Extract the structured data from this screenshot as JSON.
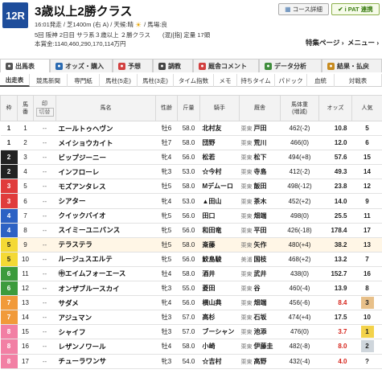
{
  "race": {
    "number": "12R",
    "name": "3歳以上2勝クラス",
    "line1_start": "16:01発走 / 芝1400m (右 A) / 天候:晴",
    "line1_end": "/ 馬場:良",
    "line2": "5回 阪神 2日目 サラ系３歳以上 ２勝クラス　　(混)[指] 定量 17頭",
    "line3": "本賞金:1140,460,290,170,114万円",
    "weather_icon": "sun-icon"
  },
  "header_buttons": {
    "course": "コース詳細",
    "ipat": "i PAT 連携"
  },
  "menu_links": {
    "special": "特集ページ",
    "more": "メニュー"
  },
  "main_tabs": [
    {
      "label": "出馬表",
      "icon": "list-icon",
      "color": "#555555"
    },
    {
      "label": "オッズ・購入",
      "icon": "odds-icon",
      "color": "#2a6ab1"
    },
    {
      "label": "予想",
      "icon": "target-icon",
      "color": "#d24040"
    },
    {
      "label": "調教",
      "icon": "stopwatch-icon",
      "color": "#444444"
    },
    {
      "label": "厩舎コメント",
      "icon": "comment-icon",
      "color": "#d24040"
    },
    {
      "label": "データ分析",
      "icon": "chart-icon",
      "color": "#3f8d3c"
    },
    {
      "label": "結果・払戻",
      "icon": "trophy-icon",
      "color": "#c78b1f"
    }
  ],
  "sub_tabs": [
    "出走表",
    "競馬新聞",
    "専門紙",
    "馬柱(5走)",
    "馬柱(3走)",
    "タイム指数",
    "メモ",
    "持ちタイム",
    "パドック",
    "血統",
    "対戦表"
  ],
  "columns": {
    "waku": "枠",
    "umaban": "馬\n番",
    "mark": "印",
    "mark_sub": "切替",
    "horse": "馬名",
    "sexage": "性齢",
    "kinryo": "斤量",
    "jockey": "騎手",
    "trainer": "厩舎",
    "weight": "馬体重\n(増減)",
    "odds": "オッズ",
    "pop": "人気"
  },
  "rows": [
    {
      "waku": "1",
      "umaban": "1",
      "mark": "--",
      "horse": "エールトゥヘヴン",
      "sexage": "牡6",
      "kinryo": "58.0",
      "jockey": "北村友",
      "belong": "栗東",
      "trainer": "戸田",
      "weight": "462(-2)",
      "odds": "10.8",
      "pop": "5"
    },
    {
      "waku": "1",
      "umaban": "2",
      "mark": "--",
      "horse": "メイショウカイト",
      "sexage": "牡7",
      "kinryo": "58.0",
      "jockey": "団野",
      "belong": "栗東",
      "trainer": "荒川",
      "weight": "466(0)",
      "odds": "12.0",
      "pop": "6"
    },
    {
      "waku": "2",
      "umaban": "3",
      "mark": "--",
      "horse": "ビップジーニー",
      "sexage": "牝4",
      "kinryo": "56.0",
      "jockey": "松若",
      "belong": "栗東",
      "trainer": "松下",
      "weight": "494(+8)",
      "odds": "57.6",
      "pop": "15"
    },
    {
      "waku": "2",
      "umaban": "4",
      "mark": "--",
      "horse": "インフローレ",
      "sexage": "牝3",
      "kinryo": "53.0",
      "jockey": "☆今村",
      "belong": "栗東",
      "trainer": "寺島",
      "weight": "412(-2)",
      "odds": "49.3",
      "pop": "14"
    },
    {
      "waku": "3",
      "umaban": "5",
      "mark": "--",
      "horse": "モズアンタレス",
      "sexage": "牡5",
      "kinryo": "58.0",
      "jockey": "Mデムーロ",
      "belong": "栗東",
      "trainer": "飯田",
      "weight": "498(-12)",
      "odds": "23.8",
      "pop": "12"
    },
    {
      "waku": "3",
      "umaban": "6",
      "mark": "--",
      "horse": "シアター",
      "sexage": "牝4",
      "kinryo": "53.0",
      "jockey": "▲田山",
      "belong": "栗東",
      "trainer": "茶木",
      "weight": "452(+2)",
      "odds": "14.0",
      "pop": "9"
    },
    {
      "waku": "4",
      "umaban": "7",
      "mark": "--",
      "horse": "クイックバイオ",
      "sexage": "牝5",
      "kinryo": "56.0",
      "jockey": "田口",
      "belong": "栗東",
      "trainer": "畑端",
      "weight": "498(0)",
      "odds": "25.5",
      "pop": "11"
    },
    {
      "waku": "4",
      "umaban": "8",
      "mark": "--",
      "horse": "スイミーユニバンス",
      "sexage": "牝5",
      "kinryo": "56.0",
      "jockey": "和田竜",
      "belong": "栗東",
      "trainer": "平田",
      "weight": "426(-18)",
      "odds": "178.4",
      "pop": "17"
    },
    {
      "waku": "5",
      "umaban": "9",
      "mark": "--",
      "horse": "テラステラ",
      "sexage": "牡5",
      "kinryo": "58.0",
      "jockey": "斎藤",
      "belong": "栗東",
      "trainer": "矢作",
      "weight": "480(+4)",
      "odds": "38.2",
      "pop": "13",
      "hl": true
    },
    {
      "waku": "5",
      "umaban": "10",
      "mark": "--",
      "horse": "ルージュスエルテ",
      "sexage": "牝5",
      "kinryo": "56.0",
      "jockey": "鮫島駿",
      "belong": "美浦",
      "trainer": "国枝",
      "weight": "468(+2)",
      "odds": "13.2",
      "pop": "7"
    },
    {
      "waku": "6",
      "umaban": "11",
      "mark": "--",
      "horse": "㊥エイムフォーエース",
      "sexage": "牡4",
      "kinryo": "58.0",
      "jockey": "酒井",
      "belong": "栗東",
      "trainer": "武井",
      "weight": "438(0)",
      "odds": "152.7",
      "pop": "16"
    },
    {
      "waku": "6",
      "umaban": "12",
      "mark": "--",
      "horse": "オンザブルースカイ",
      "sexage": "牝3",
      "kinryo": "55.0",
      "jockey": "菱田",
      "belong": "栗東",
      "trainer": "谷",
      "weight": "460(-4)",
      "odds": "13.9",
      "pop": "8"
    },
    {
      "waku": "7",
      "umaban": "13",
      "mark": "--",
      "horse": "サダメ",
      "sexage": "牝4",
      "kinryo": "56.0",
      "jockey": "横山典",
      "belong": "栗東",
      "trainer": "畑端",
      "weight": "456(-6)",
      "odds": "8.4",
      "pop": "3",
      "red": true
    },
    {
      "waku": "7",
      "umaban": "14",
      "mark": "--",
      "horse": "アジュマン",
      "sexage": "牡3",
      "kinryo": "57.0",
      "jockey": "高杉",
      "belong": "栗東",
      "trainer": "石坂",
      "weight": "474(+4)",
      "odds": "17.5",
      "pop": "10"
    },
    {
      "waku": "8",
      "umaban": "15",
      "mark": "--",
      "horse": "シャイフ",
      "sexage": "牡3",
      "kinryo": "57.0",
      "jockey": "ブーシャン",
      "belong": "栗東",
      "trainer": "池添",
      "weight": "476(0)",
      "odds": "3.7",
      "pop": "1",
      "red": true
    },
    {
      "waku": "8",
      "umaban": "16",
      "mark": "--",
      "horse": "レザンノワール",
      "sexage": "牡4",
      "kinryo": "58.0",
      "jockey": "小崎",
      "belong": "栗東",
      "trainer": "伊藤圭",
      "weight": "482(-8)",
      "odds": "8.0",
      "pop": "2",
      "red": true
    },
    {
      "waku": "8",
      "umaban": "17",
      "mark": "--",
      "horse": "チューラワンサ",
      "sexage": "牝3",
      "kinryo": "54.0",
      "jockey": "☆吉村",
      "belong": "栗東",
      "trainer": "高野",
      "weight": "432(-4)",
      "odds": "4.0",
      "pop": "?",
      "red": true
    }
  ],
  "waku_colors": {
    "1": {
      "bg": "#ffffff",
      "fg": "#222222"
    },
    "2": {
      "bg": "#222222",
      "fg": "#ffffff"
    },
    "3": {
      "bg": "#e03c3c",
      "fg": "#ffffff"
    },
    "4": {
      "bg": "#2d62c4",
      "fg": "#ffffff"
    },
    "5": {
      "bg": "#f4d935",
      "fg": "#222222"
    },
    "6": {
      "bg": "#3c9b3c",
      "fg": "#ffffff"
    },
    "7": {
      "bg": "#f19a3a",
      "fg": "#ffffff"
    },
    "8": {
      "bg": "#f27fa4",
      "fg": "#ffffff"
    }
  }
}
